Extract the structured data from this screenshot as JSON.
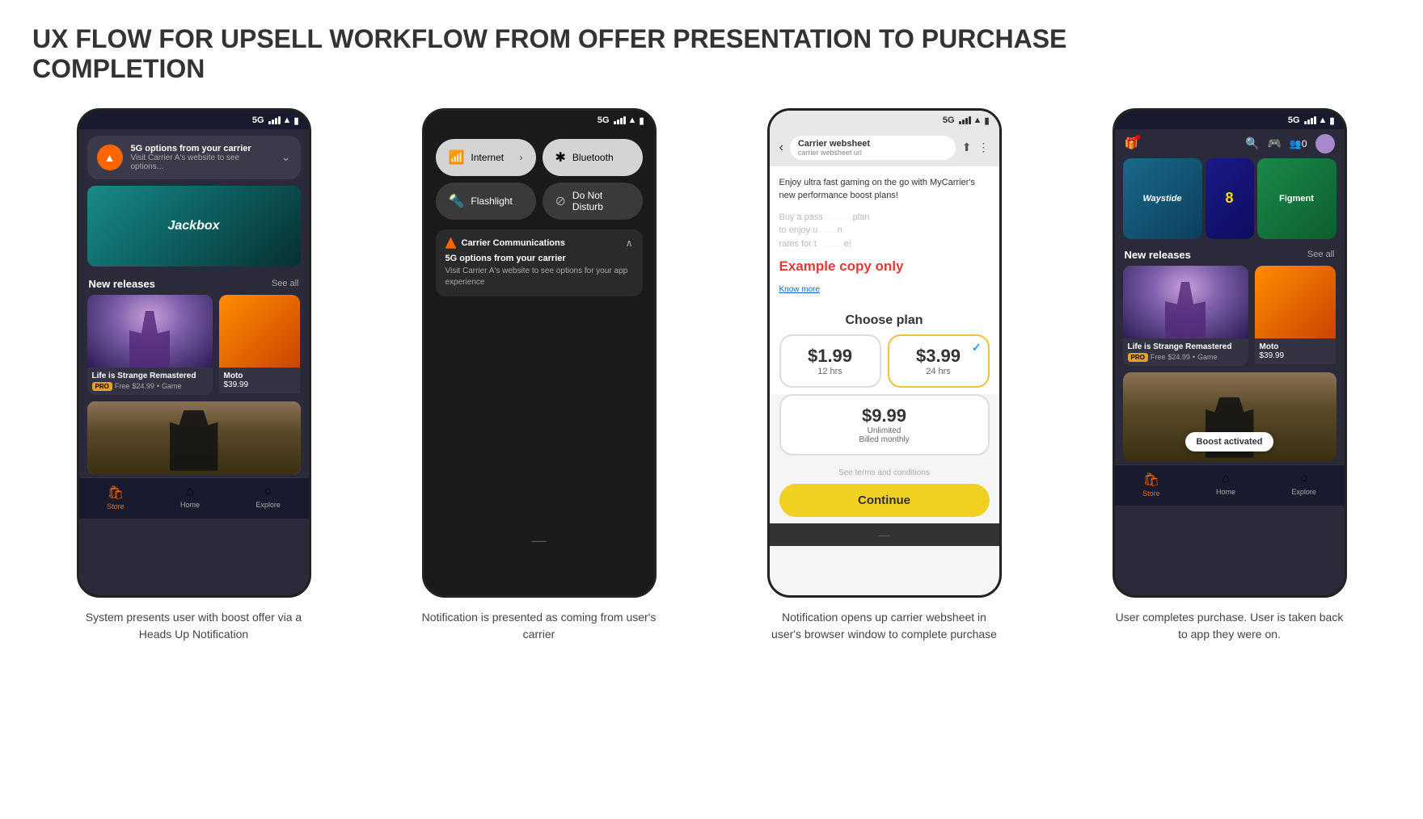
{
  "page": {
    "title": "UX FLOW FOR UPSELL WORKFLOW FROM OFFER PRESENTATION TO PURCHASE COMPLETION"
  },
  "steps": [
    {
      "id": "step1",
      "description": "System presents user with boost offer via a Heads Up Notification"
    },
    {
      "id": "step2",
      "description": "Notification is presented as coming from user's carrier"
    },
    {
      "id": "step3",
      "description": "Notification opens up carrier websheet in user's browser window to complete purchase"
    },
    {
      "id": "step4",
      "description": "User completes purchase. User is taken back to app they were on."
    }
  ],
  "screen1": {
    "status": "5G",
    "notification": {
      "title": "5G options from your carrier",
      "subtitle": "Visit Carrier A's website to see options..."
    },
    "banner_game": "Jackbox",
    "section": "New releases",
    "see_all": "See all",
    "game1_name": "Life is Strange Remastered",
    "game1_badge": "PRO",
    "game1_free": "Free",
    "game1_price": "$24.99",
    "game1_type": "Game",
    "game2_price": "$39.99",
    "nav_items": [
      "Store",
      "Home",
      "Explore"
    ]
  },
  "screen2": {
    "status": "5G",
    "tiles": [
      {
        "label": "Internet",
        "active": true,
        "icon": "wifi"
      },
      {
        "label": "Bluetooth",
        "active": true,
        "icon": "bt"
      },
      {
        "label": "Flashlight",
        "active": false,
        "icon": "flash"
      },
      {
        "label": "Do Not Disturb",
        "active": false,
        "icon": "dnd"
      }
    ],
    "carrier_notification": {
      "title": "Carrier Communications",
      "body_title": "5G options from your carrier",
      "body_text": "Visit Carrier A's website to see options for your app experience"
    }
  },
  "screen3": {
    "status": "5G",
    "toolbar_title": "Carrier websheet",
    "toolbar_url": "carrier websheet url",
    "description": "Enjoy ultra fast gaming on the go with MyCarrier's new performance boost plans!",
    "description2": "Buy a pass to enjoy ultra fast gaming rates for the best experience!",
    "example_label": "Example copy only",
    "know_more": "Know more",
    "choose_plan_title": "Choose plan",
    "plans": [
      {
        "price": "$1.99",
        "duration": "12 hrs",
        "selected": false
      },
      {
        "price": "$3.99",
        "duration": "24 hrs",
        "selected": true
      }
    ],
    "plan_wide": {
      "price": "$9.99",
      "note1": "Unlimited",
      "note2": "Billed monthly"
    },
    "terms": "See terms and conditions",
    "continue_btn": "Continue"
  },
  "screen4": {
    "status": "5G",
    "section": "New releases",
    "see_all": "See all",
    "game1_name": "Life is Strange Remastered",
    "game1_badge": "PRO",
    "game1_free": "Free",
    "game1_price": "$24.99",
    "game1_type": "Game",
    "game2_price": "$39.99",
    "boost_activated": "Boost activated",
    "nav_items": [
      "Store",
      "Home",
      "Explore"
    ]
  }
}
